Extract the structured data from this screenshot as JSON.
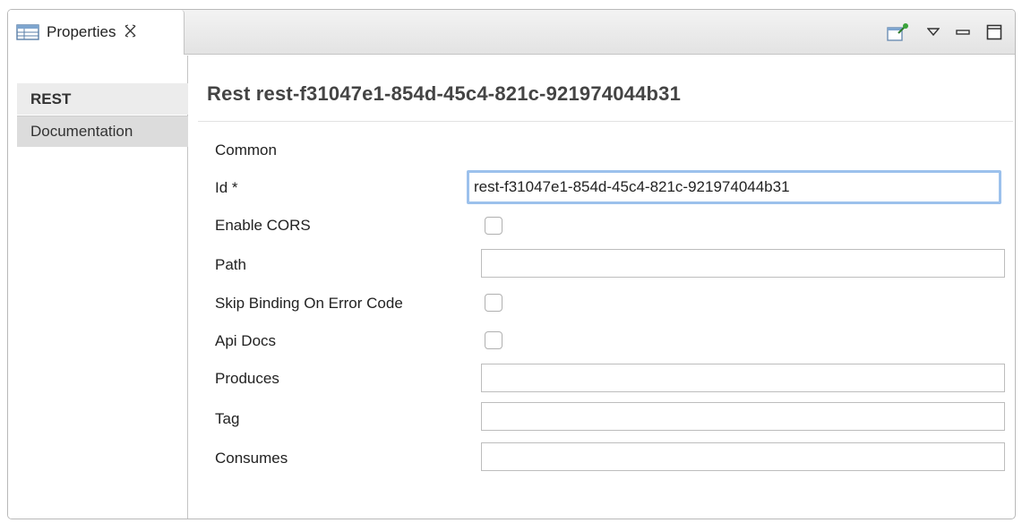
{
  "tab": {
    "title": "Properties",
    "icon": "table-icon",
    "close_icon": "close-icon"
  },
  "toolbar": {
    "icons": [
      "pin-icon",
      "view-menu-icon",
      "minimize-icon",
      "maximize-icon"
    ]
  },
  "sidebar": {
    "items": [
      {
        "label": "REST",
        "active": true
      },
      {
        "label": "Documentation",
        "active": false
      }
    ]
  },
  "main": {
    "title": "Rest rest-f31047e1-854d-45c4-821c-921974044b31",
    "section": "Common",
    "fields": {
      "id": {
        "label": "Id *",
        "value": "rest-f31047e1-854d-45c4-821c-921974044b31"
      },
      "enable_cors": {
        "label": "Enable CORS",
        "checked": false
      },
      "path": {
        "label": "Path",
        "value": ""
      },
      "skip_binding": {
        "label": "Skip Binding On Error Code",
        "checked": false
      },
      "api_docs": {
        "label": "Api Docs",
        "checked": false
      },
      "produces": {
        "label": "Produces",
        "value": ""
      },
      "tag": {
        "label": "Tag",
        "value": ""
      },
      "consumes": {
        "label": "Consumes",
        "value": ""
      }
    }
  },
  "colors": {
    "focus_ring": "#9cc1ec",
    "titlebar": "#e8e8e8",
    "active_tab": "#ececec"
  }
}
